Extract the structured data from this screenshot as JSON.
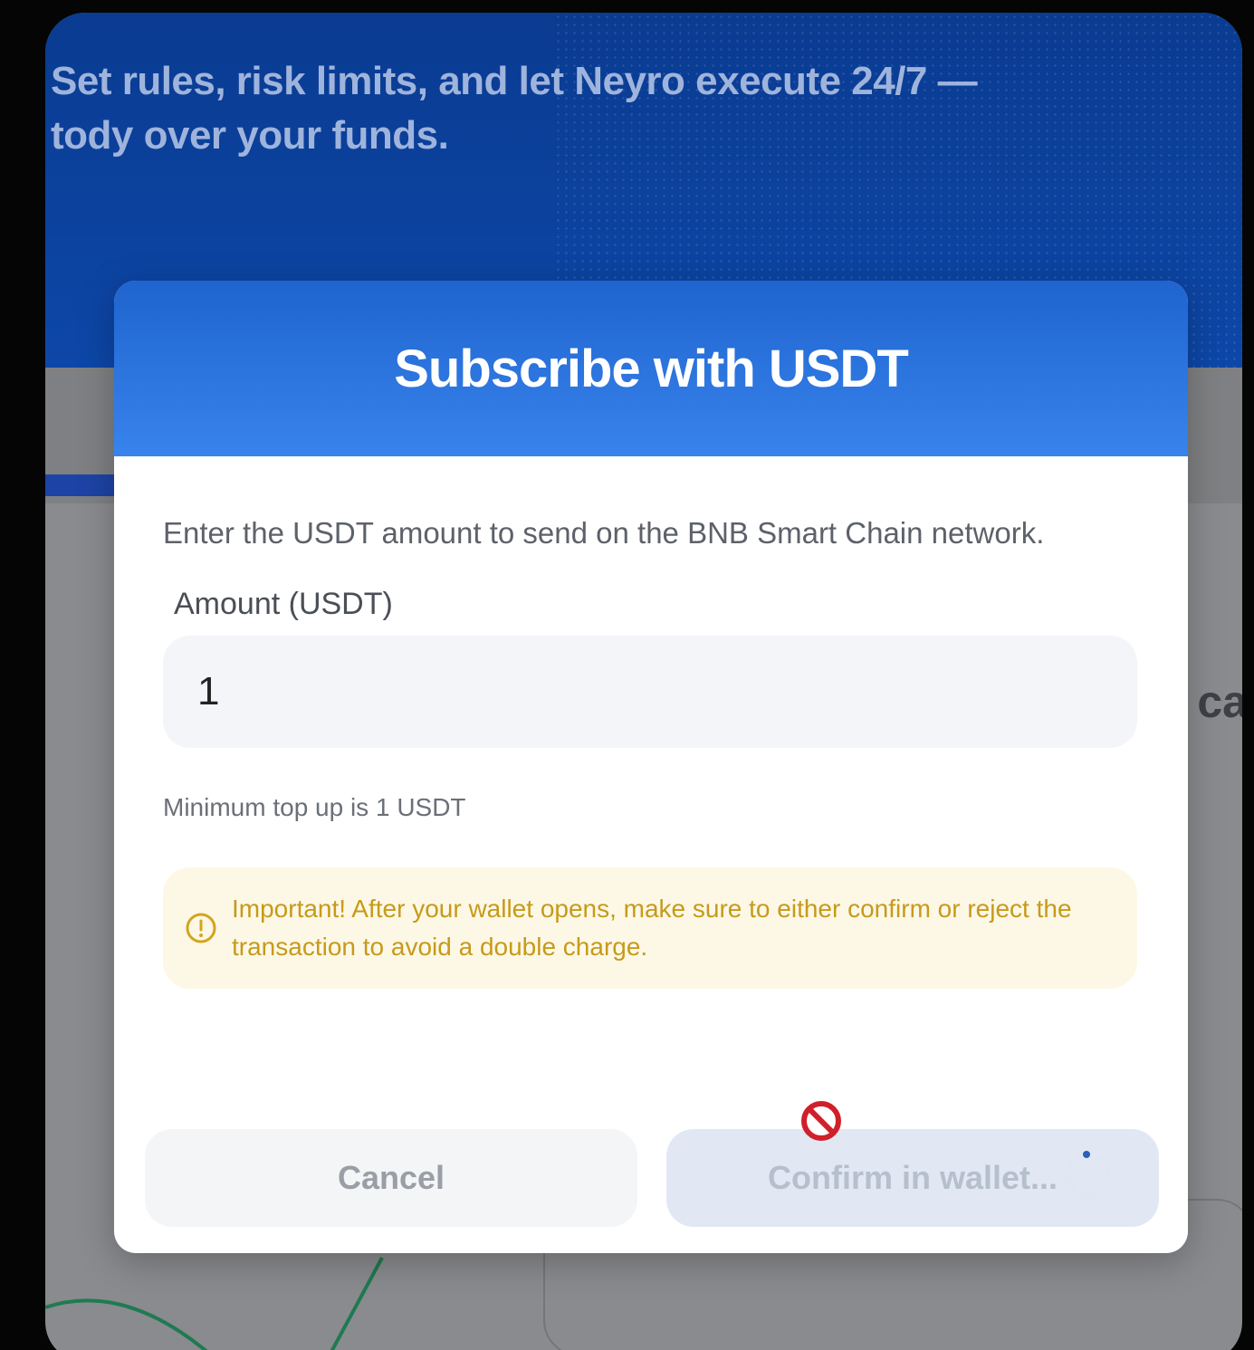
{
  "background": {
    "hero_text_line1": "Set rules, risk limits, and let Neyro execute 24/7 —",
    "hero_text_line2": "tody over your funds.",
    "side_fragment": "ca"
  },
  "modal": {
    "title": "Subscribe with USDT",
    "description": "Enter the USDT amount to send on the BNB Smart Chain network.",
    "amount_label": "Amount (USDT)",
    "amount_value": "1",
    "min_hint": "Minimum top up is 1 USDT",
    "warning_text": "Important! After your wallet opens, make sure to either confirm or reject the transaction to avoid a double charge.",
    "cancel_label": "Cancel",
    "confirm_label": "Confirm in wallet..."
  },
  "colors": {
    "header_blue": "#2a74e0",
    "warning_text": "#c79a1a",
    "warning_bg": "#fdf8e6",
    "hero_blue": "#0d47a8"
  },
  "icons": {
    "warning": "info-circle-icon",
    "cursor": "not-allowed-cursor-icon",
    "loading": "loading-spinner-icon"
  }
}
